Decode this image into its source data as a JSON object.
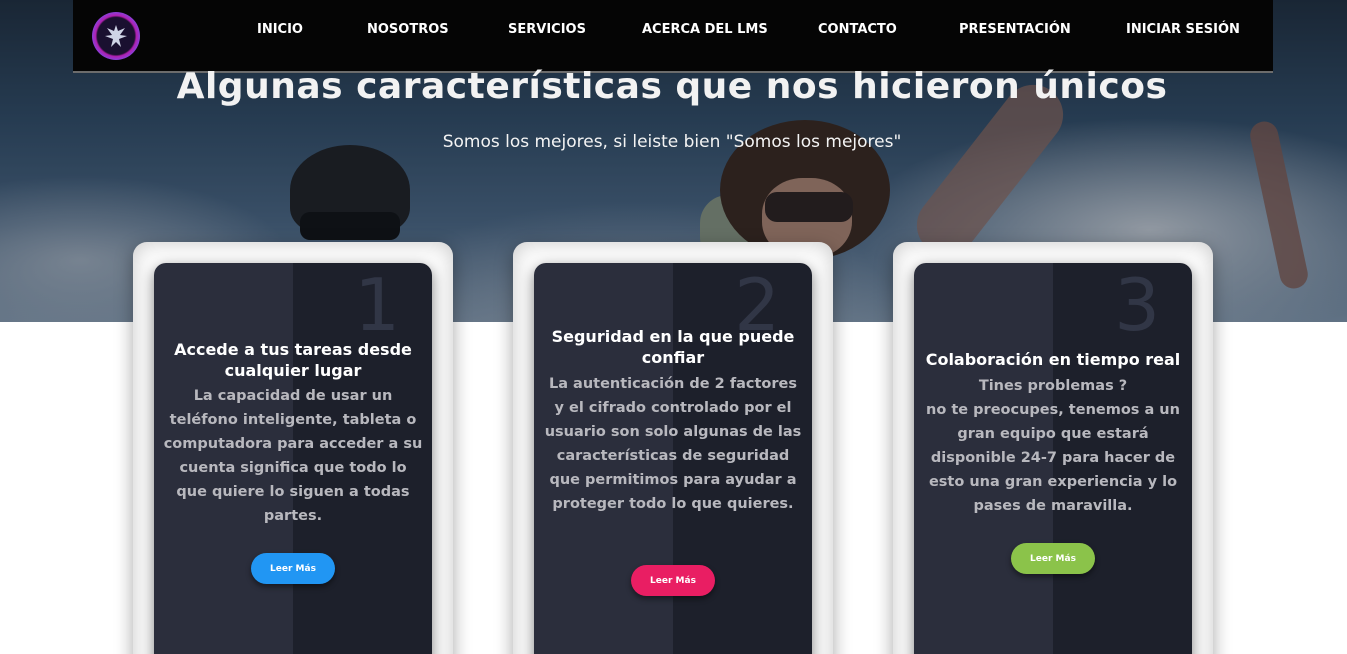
{
  "nav": {
    "items": [
      {
        "label": "INICIO"
      },
      {
        "label": "NOSOTROS"
      },
      {
        "label": "SERVICIOS"
      },
      {
        "label": "ACERCA DEL LMS"
      },
      {
        "label": "CONTACTO"
      },
      {
        "label": "PRESENTACIÓN"
      },
      {
        "label": "INICIAR SESIÓN"
      }
    ]
  },
  "section": {
    "title": "Algunas características que nos hicieron únicos",
    "subtitle": "Somos los mejores, si leiste bien \"Somos los mejores\""
  },
  "cards": [
    {
      "number": "1",
      "title": "Accede a tus tareas desde cualquier lugar",
      "text": "La capacidad de usar un teléfono inteligente, tableta o computadora para acceder a su cuenta significa que todo lo que quiere lo siguen a todas partes.",
      "button": "Leer Más",
      "button_color": "#2196f3"
    },
    {
      "number": "2",
      "title": "Seguridad en la que puede confiar",
      "text": "La autenticación de 2 factores y el cifrado controlado por el usuario son solo algunas de las características de seguridad que permitimos para ayudar a proteger todo lo que quieres.",
      "button": "Leer Más",
      "button_color": "#e91e63"
    },
    {
      "number": "3",
      "title": "Colaboración en tiempo real",
      "text": "Tines problemas ?\nno te preocupes, tenemos a un gran equipo que estará disponible 24-7 para hacer de esto una gran experiencia y lo pases de maravilla.",
      "button": "Leer Más",
      "button_color": "#8bc34a"
    }
  ],
  "icons": {
    "logo": "phoenix-logo-icon"
  }
}
